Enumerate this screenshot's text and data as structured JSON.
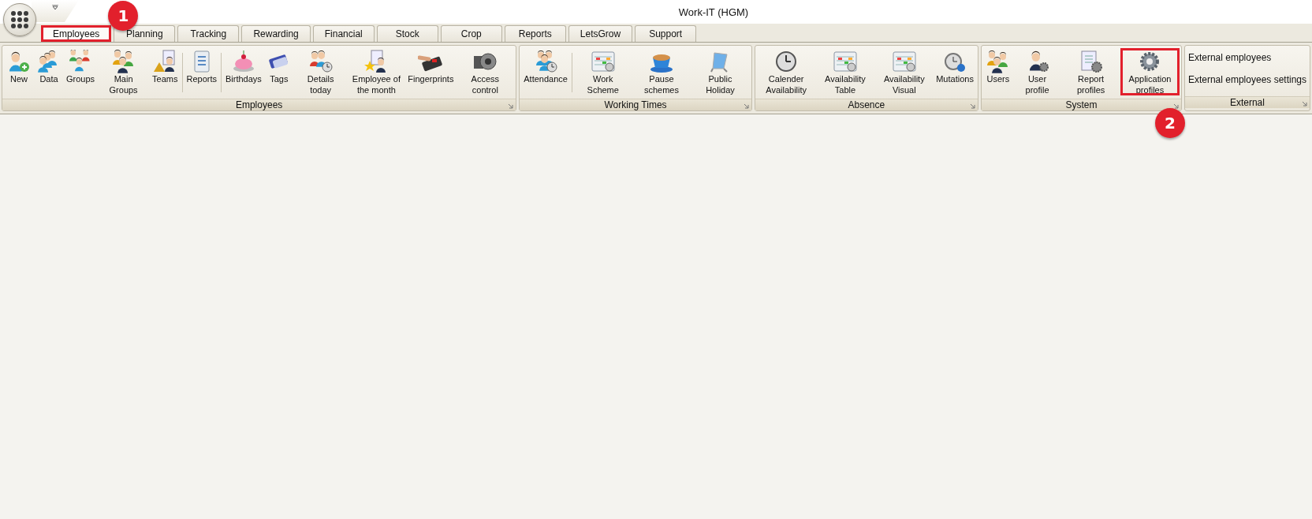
{
  "window": {
    "title": "Work-IT (HGM)"
  },
  "tabs": [
    {
      "label": "Employees",
      "selected": true,
      "highlighted": true,
      "callout": "1"
    },
    {
      "label": "Planning",
      "selected": false
    },
    {
      "label": "Tracking",
      "selected": false
    },
    {
      "label": "Rewarding",
      "selected": false
    },
    {
      "label": "Financial",
      "selected": false
    },
    {
      "label": "Stock",
      "selected": false
    },
    {
      "label": "Crop",
      "selected": false
    },
    {
      "label": "Reports",
      "selected": false
    },
    {
      "label": "LetsGrow",
      "selected": false
    },
    {
      "label": "Support",
      "selected": false
    }
  ],
  "ribbon_groups": [
    {
      "label": "Employees",
      "kind": "large",
      "buttons": [
        {
          "label": "New"
        },
        {
          "label": "Data"
        },
        {
          "label": "Groups"
        },
        {
          "label": "Main Groups"
        },
        {
          "label": "Teams",
          "separator_after": true
        },
        {
          "label": "Reports",
          "separator_after": true
        },
        {
          "label": "Birthdays"
        },
        {
          "label": "Tags"
        },
        {
          "label": "Details today"
        },
        {
          "label": "Employee of the month"
        },
        {
          "label": "Fingerprints"
        },
        {
          "label": "Access control"
        }
      ]
    },
    {
      "label": "Working Times",
      "kind": "large",
      "buttons": [
        {
          "label": "Attendance",
          "separator_after": true
        },
        {
          "label": "Work Scheme"
        },
        {
          "label": "Pause schemes"
        },
        {
          "label": "Public Holiday"
        }
      ]
    },
    {
      "label": "Absence",
      "kind": "large",
      "buttons": [
        {
          "label": "Calender Availability"
        },
        {
          "label": "Availability Table"
        },
        {
          "label": "Availability Visual"
        },
        {
          "label": "Mutations"
        }
      ]
    },
    {
      "label": "System",
      "kind": "large",
      "buttons": [
        {
          "label": "Users"
        },
        {
          "label": "User profile"
        },
        {
          "label": "Report profiles"
        },
        {
          "label": "Application profiles",
          "highlighted": true,
          "callout": "2"
        }
      ]
    },
    {
      "label": "External",
      "kind": "small",
      "buttons": [
        {
          "label": "External employees"
        },
        {
          "label": "External employees settings"
        }
      ]
    }
  ]
}
